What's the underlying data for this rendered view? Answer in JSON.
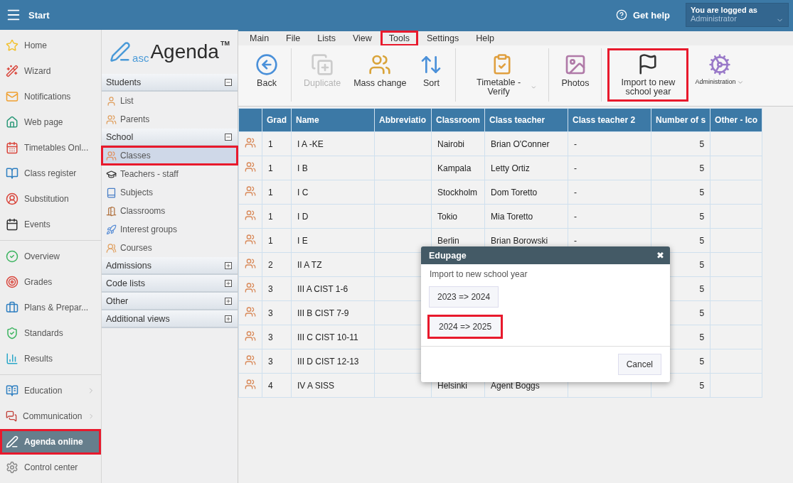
{
  "header": {
    "title": "Start",
    "help": "Get help",
    "login_label": "You are logged as",
    "login_user": "Administrator"
  },
  "nav": {
    "sections": [
      [
        {
          "label": "Home",
          "selected": false
        },
        {
          "label": "Wizard",
          "selected": false
        },
        {
          "label": "Notifications",
          "selected": false
        },
        {
          "label": "Web page",
          "selected": false
        },
        {
          "label": "Timetables Onl...",
          "selected": false
        },
        {
          "label": "Class register",
          "selected": false
        },
        {
          "label": "Substitution",
          "selected": false
        },
        {
          "label": "Events",
          "selected": false
        }
      ],
      [
        {
          "label": "Overview",
          "selected": false
        },
        {
          "label": "Grades",
          "selected": false
        },
        {
          "label": "Plans & Prepar...",
          "selected": false
        },
        {
          "label": "Standards",
          "selected": false
        },
        {
          "label": "Results",
          "selected": false
        }
      ],
      [
        {
          "label": "Education",
          "selected": false,
          "submenu": true
        },
        {
          "label": "Communication",
          "selected": false,
          "submenu": true
        },
        {
          "label": "Agenda online",
          "selected": true,
          "highlighted": true
        },
        {
          "label": "Control center",
          "selected": false
        }
      ]
    ]
  },
  "logo": {
    "prefix": "asc",
    "name": "Agenda",
    "mark": "TM"
  },
  "groups": [
    {
      "title": "Students",
      "expanded": true,
      "items": [
        {
          "label": "List",
          "selected": false
        },
        {
          "label": "Parents",
          "selected": false
        }
      ]
    },
    {
      "title": "School",
      "expanded": true,
      "items": [
        {
          "label": "Classes",
          "selected": true,
          "highlighted": true
        },
        {
          "label": "Teachers - staff",
          "selected": false
        },
        {
          "label": "Subjects",
          "selected": false
        },
        {
          "label": "Classrooms",
          "selected": false
        },
        {
          "label": "Interest groups",
          "selected": false
        },
        {
          "label": "Courses",
          "selected": false
        }
      ]
    },
    {
      "title": "Admissions",
      "expanded": false
    },
    {
      "title": "Code lists",
      "expanded": false
    },
    {
      "title": "Other",
      "expanded": false
    },
    {
      "title": "Additional views",
      "expanded": false
    }
  ],
  "menu": [
    {
      "label": "Main",
      "highlighted": false
    },
    {
      "label": "File",
      "highlighted": false
    },
    {
      "label": "Lists",
      "highlighted": false
    },
    {
      "label": "View",
      "highlighted": false
    },
    {
      "label": "Tools",
      "highlighted": true
    },
    {
      "label": "Settings",
      "highlighted": false
    },
    {
      "label": "Help",
      "highlighted": false
    }
  ],
  "toolbar": [
    [
      {
        "label": "Back",
        "disabled": false
      }
    ],
    [
      {
        "label": "Duplicate",
        "disabled": true
      },
      {
        "label": "Mass change",
        "disabled": false
      },
      {
        "label": "Sort",
        "disabled": false
      }
    ],
    [
      {
        "label": "Timetable - Verify",
        "disabled": false,
        "dropdown": true
      }
    ],
    [
      {
        "label": "Photos",
        "disabled": false
      }
    ],
    [
      {
        "label": "Import to new school year",
        "disabled": false,
        "highlighted": true
      },
      {
        "label": "Administration",
        "disabled": false,
        "dropdown": true,
        "kind": "small"
      }
    ]
  ],
  "table": {
    "columns": [
      "Grad",
      "Name",
      "Abbreviatio",
      "Classroom",
      "Class teacher",
      "Class teacher 2",
      "Number of s",
      "Other - Ico"
    ],
    "rows": [
      {
        "grade": "1",
        "name": "I A -KE",
        "classroom": "Nairobi",
        "teacher": "Brian O'Conner",
        "teacher2": "-",
        "count": "5"
      },
      {
        "grade": "1",
        "name": "I B",
        "classroom": "Kampala",
        "teacher": "Letty Ortiz",
        "teacher2": "-",
        "count": "5"
      },
      {
        "grade": "1",
        "name": "I C",
        "classroom": "Stockholm",
        "teacher": "Dom Toretto",
        "teacher2": "-",
        "count": "5"
      },
      {
        "grade": "1",
        "name": "I D",
        "classroom": "Tokio",
        "teacher": "Mia Toretto",
        "teacher2": "-",
        "count": "5"
      },
      {
        "grade": "1",
        "name": "I E",
        "classroom": "Berlin",
        "teacher": "Brian Borowski",
        "teacher2": "-",
        "count": "5"
      },
      {
        "grade": "2",
        "name": "II A TZ",
        "count": "5"
      },
      {
        "grade": "3",
        "name": "III A CIST 1-6",
        "count": "5"
      },
      {
        "grade": "3",
        "name": "III B CIST 7-9",
        "count": "5"
      },
      {
        "grade": "3",
        "name": "III C CIST 10-11",
        "count": "5"
      },
      {
        "grade": "3",
        "name": "III D CIST 12-13",
        "count": "5"
      },
      {
        "grade": "4",
        "name": "IV A SISS",
        "classroom": "Helsinki",
        "teacher": "Agent Boggs",
        "count": "5"
      }
    ]
  },
  "dialog": {
    "title": "Edupage",
    "close": "✖",
    "subtitle": "Import to new school year",
    "options": [
      {
        "label": "2023 => 2024",
        "highlighted": false
      },
      {
        "label": "2024 => 2025",
        "highlighted": true
      }
    ],
    "cancel": "Cancel"
  }
}
